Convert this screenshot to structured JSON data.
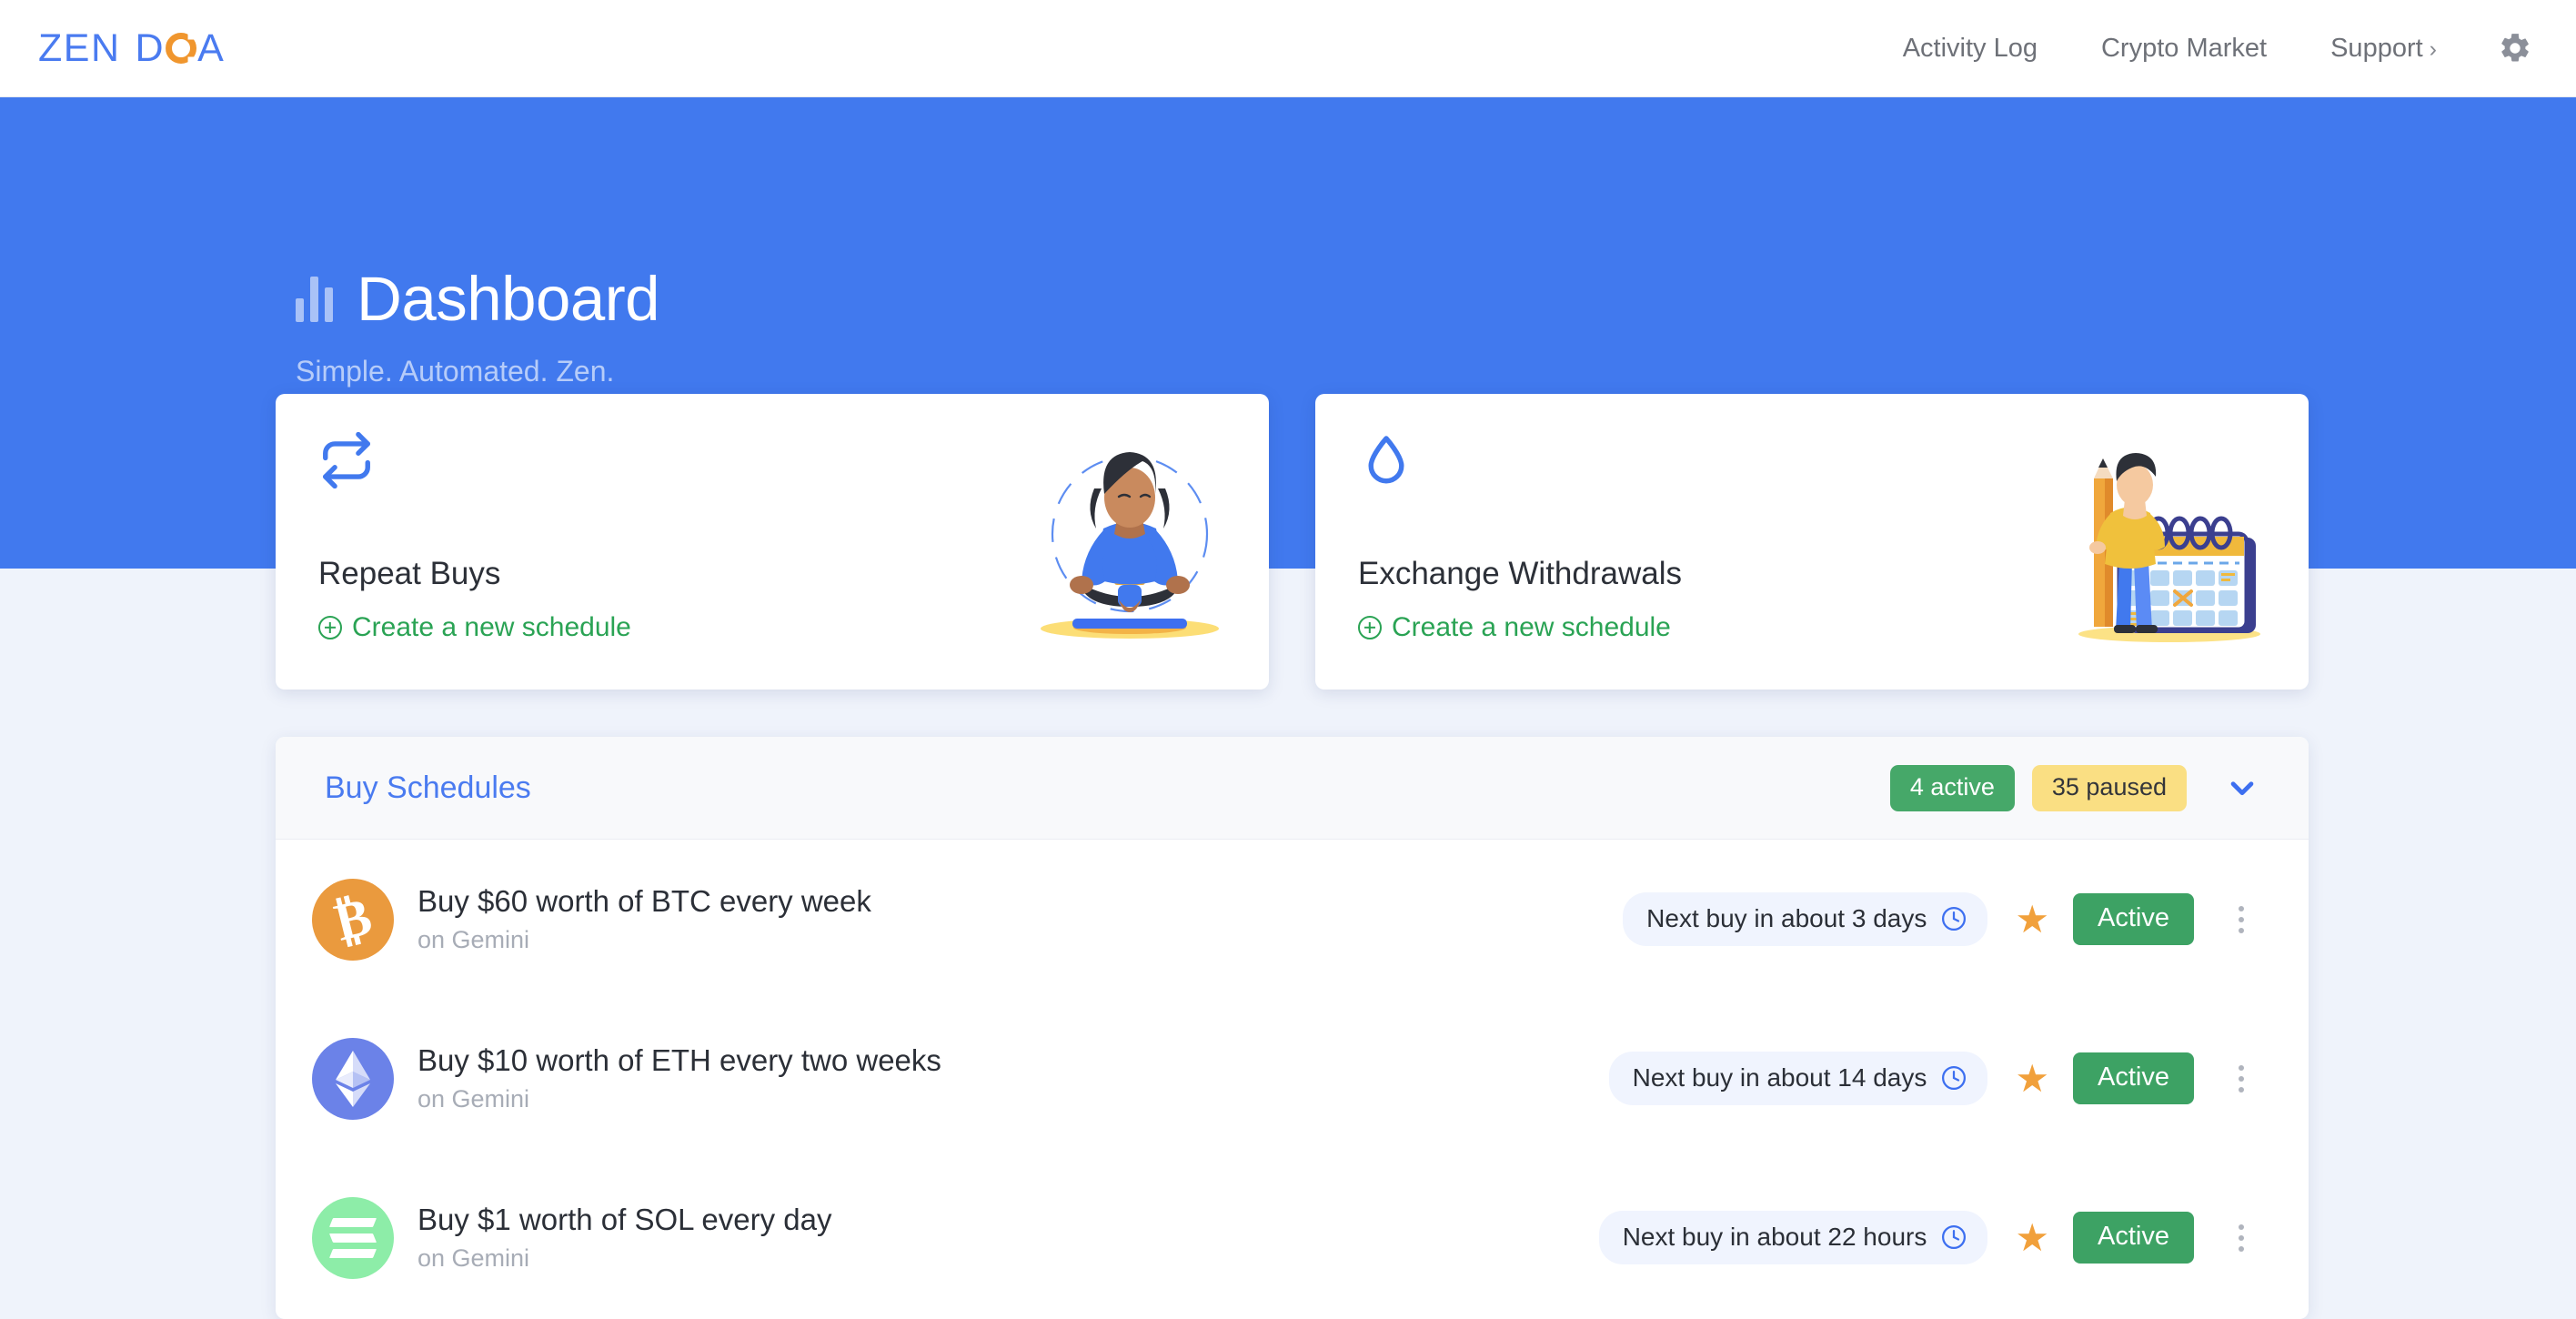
{
  "brand": {
    "part1": "ZEN",
    "part2": "D",
    "part3": "A"
  },
  "nav": {
    "items": [
      {
        "label": "Activity Log"
      },
      {
        "label": "Crypto Market"
      },
      {
        "label": "Support",
        "chevron": "›"
      }
    ],
    "settings_icon": "gear-icon"
  },
  "hero": {
    "title": "Dashboard",
    "subtitle": "Simple. Automated. Zen.",
    "icon": "bar-chart-icon",
    "bg_color": "#4179ee"
  },
  "cards": [
    {
      "icon": "repeat-icon",
      "title": "Repeat Buys",
      "link_label": "Create a new schedule",
      "illustration": "meditating-woman-illustration"
    },
    {
      "icon": "droplet-icon",
      "title": "Exchange Withdrawals",
      "link_label": "Create a new schedule",
      "illustration": "man-with-pencil-calendar-illustration"
    }
  ],
  "schedules_panel": {
    "title": "Buy Schedules",
    "active_badge": "4 active",
    "paused_badge": "35 paused",
    "collapse_icon": "chevron-down-icon",
    "colors": {
      "active": "#46a869",
      "paused": "#fadf83",
      "accent": "#4a7bf0"
    },
    "rows": [
      {
        "coin": "BTC",
        "title": "Buy $60 worth of BTC every week",
        "subtitle": "on Gemini",
        "next_buy": "Next buy in about 3 days",
        "status": "Active",
        "starred": true
      },
      {
        "coin": "ETH",
        "title": "Buy $10 worth of ETH every two weeks",
        "subtitle": "on Gemini",
        "next_buy": "Next buy in about 14 days",
        "status": "Active",
        "starred": true
      },
      {
        "coin": "SOL",
        "title": "Buy $1 worth of SOL every day",
        "subtitle": "on Gemini",
        "next_buy": "Next buy in about 22 hours",
        "status": "Active",
        "starred": true
      }
    ]
  }
}
